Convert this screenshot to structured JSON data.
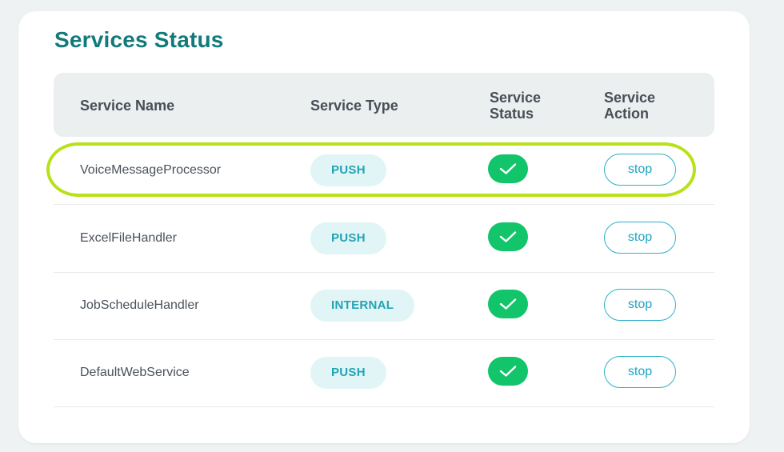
{
  "card": {
    "title": "Services Status"
  },
  "table": {
    "headers": {
      "name": "Service Name",
      "type": "Service Type",
      "status_line1": "Service",
      "status_line2": "Status",
      "action_line1": "Service",
      "action_line2": "Action"
    },
    "rows": [
      {
        "name": "VoiceMessageProcessor",
        "type": "PUSH",
        "status": "check-circle-icon",
        "action": "stop"
      },
      {
        "name": "ExcelFileHandler",
        "type": "PUSH",
        "status": "check-circle-icon",
        "action": "stop"
      },
      {
        "name": "JobScheduleHandler",
        "type": "INTERNAL",
        "status": "check-circle-icon",
        "action": "stop"
      },
      {
        "name": "DefaultWebService",
        "type": "PUSH",
        "status": "check-circle-icon",
        "action": "stop"
      }
    ]
  },
  "colors": {
    "title": "#127a7a",
    "badge_bg": "#e1f5f6",
    "badge_text": "#22a4b3",
    "status_ok": "#12c46a",
    "button_border": "#2bb0c8",
    "highlight": "#b8e11a"
  }
}
